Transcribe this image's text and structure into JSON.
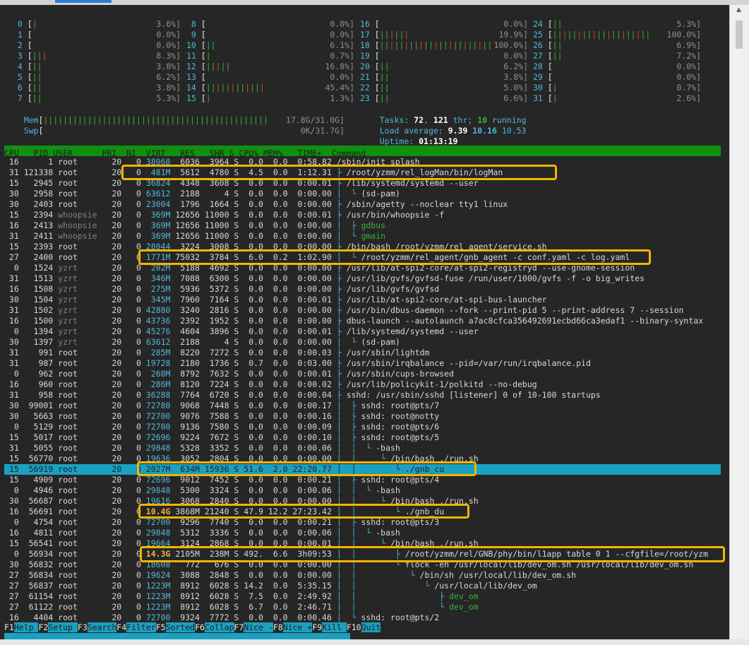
{
  "cpu_meters": [
    {
      "id": "0",
      "bar": "|",
      "pct": "3.6%]"
    },
    {
      "id": "1",
      "bar": "",
      "pct": "0.0%]"
    },
    {
      "id": "2",
      "bar": "",
      "pct": "0.0%]"
    },
    {
      "id": "3",
      "bar": "|||",
      "pct": "8.3%]"
    },
    {
      "id": "4",
      "bar": "||",
      "pct": "3.8%]"
    },
    {
      "id": "5",
      "bar": "||",
      "pct": "6.2%]"
    },
    {
      "id": "6",
      "bar": "||",
      "pct": "3.8%]"
    },
    {
      "id": "7",
      "bar": "||",
      "pct": "5.3%]"
    },
    {
      "id": "8",
      "bar": "",
      "pct": "0.0%]"
    },
    {
      "id": "9",
      "bar": "",
      "pct": "0.0%]"
    },
    {
      "id": "10",
      "bar": "||",
      "pct": "6.1%]"
    },
    {
      "id": "11",
      "bar": "|",
      "pct": "0.7%]"
    },
    {
      "id": "12",
      "bar": "|||||",
      "pct": "16.8%]"
    },
    {
      "id": "13",
      "bar": "",
      "pct": "0.0%]"
    },
    {
      "id": "14",
      "bar": "||||||||||||",
      "pct": "45.4%]"
    },
    {
      "id": "15",
      "bar": "|",
      "pct": "1.3%]"
    },
    {
      "id": "16",
      "bar": "",
      "pct": "0.0%]"
    },
    {
      "id": "17",
      "bar": "||||||",
      "pct": "19.9%]"
    },
    {
      "id": "18",
      "bar": "|||||||||||||||||||||||",
      "pct": "100.0%]"
    },
    {
      "id": "19",
      "bar": "",
      "pct": "0.0%]"
    },
    {
      "id": "20",
      "bar": "||",
      "pct": "6.2%]"
    },
    {
      "id": "21",
      "bar": "||",
      "pct": "3.8%]"
    },
    {
      "id": "22",
      "bar": "||",
      "pct": "5.0%]"
    },
    {
      "id": "23",
      "bar": "||",
      "pct": "6.6%]"
    },
    {
      "id": "24",
      "bar": "||",
      "pct": "5.3%]"
    },
    {
      "id": "25",
      "bar": "||||||||||||||||||||",
      "pct": "100.0%]"
    },
    {
      "id": "26",
      "bar": "||",
      "pct": "6.9%]"
    },
    {
      "id": "27",
      "bar": "||",
      "pct": "7.2%]"
    },
    {
      "id": "28",
      "bar": "",
      "pct": "0.0%]"
    },
    {
      "id": "29",
      "bar": "",
      "pct": "0.0%]"
    },
    {
      "id": "30",
      "bar": "|",
      "pct": "0.7%]"
    },
    {
      "id": "31",
      "bar": "|",
      "pct": "2.6%]"
    }
  ],
  "mem": {
    "label": "Mem",
    "bar": "||||||||||||||||||||||||||||||||||||||||||||||",
    "value": "17.8G/31.0G]"
  },
  "swp": {
    "label": "Swp",
    "bar": "",
    "value": "0K/31.7G]"
  },
  "tasks": {
    "label": "Tasks: ",
    "count": "72",
    "sep": ", ",
    "thr": "121",
    "thr_label": " thr; ",
    "running": "10",
    "running_label": " running"
  },
  "load": {
    "label": "Load average: ",
    "one": "9.39",
    "five": "10.16",
    "fifteen": "10.53"
  },
  "uptime": {
    "label": "Uptime: ",
    "value": "01:13:19"
  },
  "header": "CPU   PID USER      PRI  NI  VIRT   RES   SHR S CPU% MEM%   TIME+  Command",
  "processes": [
    {
      "cpu": "16",
      "pid": "1",
      "user": "root",
      "pri": "20",
      "ni": "0",
      "virt": "38068",
      "res": "6036",
      "shr": "3964",
      "s": "S",
      "cpupct": "0.0",
      "mem": "0.0",
      "time": "0:58.82",
      "tree": "",
      "cmd": "/sbin/init splash"
    },
    {
      "cpu": "31",
      "pid": "121338",
      "user": "root",
      "pri": "20",
      "ni": "0",
      "virt": "481M",
      "res": "5612",
      "shr": "4780",
      "s": "S",
      "cpupct": "4.5",
      "mem": "0.0",
      "time": "1:12.31",
      "tree": "├ ",
      "cmd": "/root/yzmm/rel_logMan/bin/logMan"
    },
    {
      "cpu": "15",
      "pid": "2945",
      "user": "root",
      "pri": "20",
      "ni": "0",
      "virt": "36824",
      "res": "4348",
      "shr": "3608",
      "s": "S",
      "cpupct": "0.0",
      "mem": "0.0",
      "time": "0:00.01",
      "tree": "├ ",
      "cmd": "/lib/systemd/systemd --user"
    },
    {
      "cpu": "30",
      "pid": "2958",
      "user": "root",
      "pri": "20",
      "ni": "0",
      "virt": "63612",
      "res": "2188",
      "shr": "4",
      "s": "S",
      "cpupct": "0.0",
      "mem": "0.0",
      "time": "0:00.00",
      "tree": "│  └ ",
      "cmd": "(sd-pam)"
    },
    {
      "cpu": "30",
      "pid": "2403",
      "user": "root",
      "pri": "20",
      "ni": "0",
      "virt": "23004",
      "res": "1796",
      "shr": "1664",
      "s": "S",
      "cpupct": "0.0",
      "mem": "0.0",
      "time": "0:00.00",
      "tree": "├ ",
      "cmd": "/sbin/agetty --noclear tty1 linux"
    },
    {
      "cpu": "15",
      "pid": "2394",
      "user": "whoopsie",
      "pri": "20",
      "ni": "0",
      "virt": "369M",
      "res": "12656",
      "shr": "11000",
      "s": "S",
      "cpupct": "0.0",
      "mem": "0.0",
      "time": "0:00.01",
      "tree": "├ ",
      "cmd": "/usr/bin/whoopsie -f"
    },
    {
      "cpu": "16",
      "pid": "2413",
      "user": "whoopsie",
      "pri": "20",
      "ni": "0",
      "virt": "369M",
      "res": "12656",
      "shr": "11000",
      "s": "S",
      "cpupct": "0.0",
      "mem": "0.0",
      "time": "0:00.00",
      "tree": "│  ├ ",
      "cmd": "gdbus",
      "thr": true
    },
    {
      "cpu": "31",
      "pid": "2411",
      "user": "whoopsie",
      "pri": "20",
      "ni": "0",
      "virt": "369M",
      "res": "12656",
      "shr": "11000",
      "s": "S",
      "cpupct": "0.0",
      "mem": "0.0",
      "time": "0:00.00",
      "tree": "│  └ ",
      "cmd": "gmain",
      "thr": true
    },
    {
      "cpu": "15",
      "pid": "2393",
      "user": "root",
      "pri": "20",
      "ni": "0",
      "virt": "28044",
      "res": "3224",
      "shr": "3008",
      "s": "S",
      "cpupct": "0.0",
      "mem": "0.0",
      "time": "0:00.00",
      "tree": "├ ",
      "cmd": "/bin/bash /root/yzmm/rel_agent/service.sh"
    },
    {
      "cpu": "27",
      "pid": "2400",
      "user": "root",
      "pri": "20",
      "ni": "0",
      "virt": "1771M",
      "res": "75032",
      "shr": "3784",
      "s": "S",
      "cpupct": "6.0",
      "mem": "0.2",
      "time": "1:02.90",
      "tree": "│  └ ",
      "cmd": "/root/yzmm/rel_agent/gnb_agent -c conf.yaml -c log.yaml"
    },
    {
      "cpu": "0",
      "pid": "1524",
      "user": "yzrt",
      "pri": "20",
      "ni": "0",
      "virt": "202M",
      "res": "5188",
      "shr": "4692",
      "s": "S",
      "cpupct": "0.0",
      "mem": "0.0",
      "time": "0:00.00",
      "tree": "├ ",
      "cmd": "/usr/lib/at-spi2-core/at-spi2-registryd --use-gnome-session"
    },
    {
      "cpu": "31",
      "pid": "1513",
      "user": "yzrt",
      "pri": "20",
      "ni": "0",
      "virt": "346M",
      "res": "7088",
      "shr": "6300",
      "s": "S",
      "cpupct": "0.0",
      "mem": "0.0",
      "time": "0:00.00",
      "tree": "├ ",
      "cmd": "/usr/lib/gvfs/gvfsd-fuse /run/user/1000/gvfs -f -o big_writes"
    },
    {
      "cpu": "16",
      "pid": "1508",
      "user": "yzrt",
      "pri": "20",
      "ni": "0",
      "virt": "275M",
      "res": "5936",
      "shr": "5372",
      "s": "S",
      "cpupct": "0.0",
      "mem": "0.0",
      "time": "0:00.00",
      "tree": "├ ",
      "cmd": "/usr/lib/gvfs/gvfsd"
    },
    {
      "cpu": "30",
      "pid": "1504",
      "user": "yzrt",
      "pri": "20",
      "ni": "0",
      "virt": "345M",
      "res": "7960",
      "shr": "7164",
      "s": "S",
      "cpupct": "0.0",
      "mem": "0.0",
      "time": "0:00.01",
      "tree": "├ ",
      "cmd": "/usr/lib/at-spi2-core/at-spi-bus-launcher"
    },
    {
      "cpu": "31",
      "pid": "1502",
      "user": "yzrt",
      "pri": "20",
      "ni": "0",
      "virt": "42880",
      "res": "3240",
      "shr": "2816",
      "s": "S",
      "cpupct": "0.0",
      "mem": "0.0",
      "time": "0:00.00",
      "tree": "├ ",
      "cmd": "/usr/bin/dbus-daemon --fork --print-pid 5 --print-address 7 --session"
    },
    {
      "cpu": "16",
      "pid": "1500",
      "user": "yzrt",
      "pri": "20",
      "ni": "0",
      "virt": "43736",
      "res": "2392",
      "shr": "1952",
      "s": "S",
      "cpupct": "0.0",
      "mem": "0.0",
      "time": "0:00.00",
      "tree": "├ ",
      "cmd": "dbus-launch --autolaunch a7ac8cfca356492691ecbd66ca3edaf1 --binary-syntax"
    },
    {
      "cpu": "0",
      "pid": "1394",
      "user": "yzrt",
      "pri": "20",
      "ni": "0",
      "virt": "45276",
      "res": "4604",
      "shr": "3896",
      "s": "S",
      "cpupct": "0.0",
      "mem": "0.0",
      "time": "0:00.01",
      "tree": "├ ",
      "cmd": "/lib/systemd/systemd --user"
    },
    {
      "cpu": "30",
      "pid": "1397",
      "user": "yzrt",
      "pri": "20",
      "ni": "0",
      "virt": "63612",
      "res": "2188",
      "shr": "4",
      "s": "S",
      "cpupct": "0.0",
      "mem": "0.0",
      "time": "0:00.00",
      "tree": "│  └ ",
      "cmd": "(sd-pam)"
    },
    {
      "cpu": "31",
      "pid": "991",
      "user": "root",
      "pri": "20",
      "ni": "0",
      "virt": "285M",
      "res": "8220",
      "shr": "7272",
      "s": "S",
      "cpupct": "0.0",
      "mem": "0.0",
      "time": "0:00.03",
      "tree": "├ ",
      "cmd": "/usr/sbin/lightdm"
    },
    {
      "cpu": "31",
      "pid": "987",
      "user": "root",
      "pri": "20",
      "ni": "0",
      "virt": "19728",
      "res": "2180",
      "shr": "1736",
      "s": "S",
      "cpupct": "0.7",
      "mem": "0.0",
      "time": "0:03.00",
      "tree": "├ ",
      "cmd": "/usr/sbin/irqbalance --pid=/var/run/irqbalance.pid"
    },
    {
      "cpu": "0",
      "pid": "962",
      "user": "root",
      "pri": "20",
      "ni": "0",
      "virt": "268M",
      "res": "8792",
      "shr": "7632",
      "s": "S",
      "cpupct": "0.0",
      "mem": "0.0",
      "time": "0:00.01",
      "tree": "├ ",
      "cmd": "/usr/sbin/cups-browsed"
    },
    {
      "cpu": "16",
      "pid": "960",
      "user": "root",
      "pri": "20",
      "ni": "0",
      "virt": "286M",
      "res": "8120",
      "shr": "7224",
      "s": "S",
      "cpupct": "0.0",
      "mem": "0.0",
      "time": "0:00.02",
      "tree": "├ ",
      "cmd": "/usr/lib/policykit-1/polkitd --no-debug"
    },
    {
      "cpu": "31",
      "pid": "958",
      "user": "root",
      "pri": "20",
      "ni": "0",
      "virt": "36288",
      "res": "7764",
      "shr": "6720",
      "s": "S",
      "cpupct": "0.0",
      "mem": "0.0",
      "time": "0:00.04",
      "tree": "├ ",
      "cmd": "sshd: /usr/sbin/sshd [listener] 0 of 10-100 startups"
    },
    {
      "cpu": "30",
      "pid": "99001",
      "user": "root",
      "pri": "20",
      "ni": "0",
      "virt": "72780",
      "res": "9068",
      "shr": "7448",
      "s": "S",
      "cpupct": "0.0",
      "mem": "0.0",
      "time": "0:00.17",
      "tree": "│  ├ ",
      "cmd": "sshd: root@pts/7"
    },
    {
      "cpu": "30",
      "pid": "5663",
      "user": "root",
      "pri": "20",
      "ni": "0",
      "virt": "72700",
      "res": "9076",
      "shr": "7588",
      "s": "S",
      "cpupct": "0.0",
      "mem": "0.0",
      "time": "0:00.16",
      "tree": "│  ├ ",
      "cmd": "sshd: root@notty"
    },
    {
      "cpu": "0",
      "pid": "5129",
      "user": "root",
      "pri": "20",
      "ni": "0",
      "virt": "72700",
      "res": "9136",
      "shr": "7580",
      "s": "S",
      "cpupct": "0.0",
      "mem": "0.0",
      "time": "0:00.09",
      "tree": "│  ├ ",
      "cmd": "sshd: root@pts/6"
    },
    {
      "cpu": "15",
      "pid": "5017",
      "user": "root",
      "pri": "20",
      "ni": "0",
      "virt": "72696",
      "res": "9224",
      "shr": "7672",
      "s": "S",
      "cpupct": "0.0",
      "mem": "0.0",
      "time": "0:00.10",
      "tree": "│  ├ ",
      "cmd": "sshd: root@pts/5"
    },
    {
      "cpu": "31",
      "pid": "5055",
      "user": "root",
      "pri": "20",
      "ni": "0",
      "virt": "29848",
      "res": "5328",
      "shr": "3352",
      "s": "S",
      "cpupct": "0.0",
      "mem": "0.0",
      "time": "0:00.06",
      "tree": "│  │  └ ",
      "cmd": "-bash"
    },
    {
      "cpu": "15",
      "pid": "56770",
      "user": "root",
      "pri": "20",
      "ni": "0",
      "virt": "19636",
      "res": "3052",
      "shr": "2804",
      "s": "S",
      "cpupct": "0.0",
      "mem": "0.0",
      "time": "0:00.00",
      "tree": "│  │     └ ",
      "cmd": "/bin/bash ./run.sh"
    },
    {
      "cpu": "15",
      "pid": "56919",
      "user": "root",
      "pri": "20",
      "ni": "0",
      "virt": "2027M",
      "res": "634M",
      "shr": "15936",
      "s": "S",
      "cpupct": "51.6",
      "mem": "2.0",
      "time": "22:20.77",
      "tree": "│  │        └ ",
      "cmd": "./gnb_cu",
      "selected": true
    },
    {
      "cpu": "15",
      "pid": "4909",
      "user": "root",
      "pri": "20",
      "ni": "0",
      "virt": "72696",
      "res": "9012",
      "shr": "7452",
      "s": "S",
      "cpupct": "0.0",
      "mem": "0.0",
      "time": "0:00.21",
      "tree": "│  ├ ",
      "cmd": "sshd: root@pts/4"
    },
    {
      "cpu": "0",
      "pid": "4946",
      "user": "root",
      "pri": "20",
      "ni": "0",
      "virt": "29848",
      "res": "5300",
      "shr": "3324",
      "s": "S",
      "cpupct": "0.0",
      "mem": "0.0",
      "time": "0:00.06",
      "tree": "│  │  └ ",
      "cmd": "-bash"
    },
    {
      "cpu": "30",
      "pid": "56687",
      "user": "root",
      "pri": "20",
      "ni": "0",
      "virt": "19616",
      "res": "3068",
      "shr": "2840",
      "s": "S",
      "cpupct": "0.0",
      "mem": "0.0",
      "time": "0:00.00",
      "tree": "│  │     └ ",
      "cmd": "/bin/bash ./run.sh"
    },
    {
      "cpu": "16",
      "pid": "56691",
      "user": "root",
      "pri": "20",
      "ni": "0",
      "virt": "10.4G",
      "res": "3868M",
      "shr": "21240",
      "s": "S",
      "cpupct": "47.9",
      "mem": "12.2",
      "time": "27:23.42",
      "tree": "│  │        └ ",
      "cmd": "./gnb_du",
      "big": true
    },
    {
      "cpu": "0",
      "pid": "4754",
      "user": "root",
      "pri": "20",
      "ni": "0",
      "virt": "72700",
      "res": "9296",
      "shr": "7740",
      "s": "S",
      "cpupct": "0.0",
      "mem": "0.0",
      "time": "0:00.21",
      "tree": "│  ├ ",
      "cmd": "sshd: root@pts/3"
    },
    {
      "cpu": "16",
      "pid": "4811",
      "user": "root",
      "pri": "20",
      "ni": "0",
      "virt": "29848",
      "res": "5312",
      "shr": "3336",
      "s": "S",
      "cpupct": "0.0",
      "mem": "0.0",
      "time": "0:00.06",
      "tree": "│  │  └ ",
      "cmd": "-bash"
    },
    {
      "cpu": "15",
      "pid": "56541",
      "user": "root",
      "pri": "20",
      "ni": "0",
      "virt": "19664",
      "res": "3124",
      "shr": "2868",
      "s": "S",
      "cpupct": "0.0",
      "mem": "0.0",
      "time": "0:00.01",
      "tree": "│  │     └ ",
      "cmd": "/bin/bash ./run.sh"
    },
    {
      "cpu": "0",
      "pid": "56934",
      "user": "root",
      "pri": "20",
      "ni": "0",
      "virt": "14.3G",
      "res": "2105M",
      "shr": "238M",
      "s": "S",
      "cpupct": "492.",
      "mem": "6.6",
      "time": "3h09:53",
      "tree": "│  │        ├ ",
      "cmd": "/root/yzmm/rel/GNB/phy/bin/l1app table 0 1 --cfgfile=/root/yzm",
      "big": true
    },
    {
      "cpu": "30",
      "pid": "56832",
      "user": "root",
      "pri": "20",
      "ni": "0",
      "virt": "18608",
      "res": "772",
      "shr": "676",
      "s": "S",
      "cpupct": "0.0",
      "mem": "0.0",
      "time": "0:00.00",
      "tree": "│  │        └ ",
      "cmd": "flock -en /usr/local/lib/dev_om.sh /usr/local/lib/dev_om.sh"
    },
    {
      "cpu": "27",
      "pid": "56834",
      "user": "root",
      "pri": "20",
      "ni": "0",
      "virt": "19624",
      "res": "3088",
      "shr": "2848",
      "s": "S",
      "cpupct": "0.0",
      "mem": "0.0",
      "time": "0:00.00",
      "tree": "│  │           └ ",
      "cmd": "/bin/sh /usr/local/lib/dev_om.sh"
    },
    {
      "cpu": "27",
      "pid": "56837",
      "user": "root",
      "pri": "20",
      "ni": "0",
      "virt": "1223M",
      "res": "8912",
      "shr": "6028",
      "s": "S",
      "cpupct": "14.2",
      "mem": "0.0",
      "time": "5:35.15",
      "tree": "│  │              └ ",
      "cmd": "/usr/local/lib/dev_om"
    },
    {
      "cpu": "27",
      "pid": "61154",
      "user": "root",
      "pri": "20",
      "ni": "0",
      "virt": "1223M",
      "res": "8912",
      "shr": "6028",
      "s": "S",
      "cpupct": "7.5",
      "mem": "0.0",
      "time": "2:49.92",
      "tree": "│  │                 ├ ",
      "cmd": "dev_om",
      "thr": true
    },
    {
      "cpu": "27",
      "pid": "61122",
      "user": "root",
      "pri": "20",
      "ni": "0",
      "virt": "1223M",
      "res": "8912",
      "shr": "6028",
      "s": "S",
      "cpupct": "6.7",
      "mem": "0.0",
      "time": "2:46.71",
      "tree": "│  │                 └ ",
      "cmd": "dev_om",
      "thr": true
    },
    {
      "cpu": "16",
      "pid": "4404",
      "user": "root",
      "pri": "20",
      "ni": "0",
      "virt": "72700",
      "res": "9324",
      "shr": "7772",
      "s": "S",
      "cpupct": "0.0",
      "mem": "0.0",
      "time": "0:00.46",
      "tree": "│  └ ",
      "cmd": "sshd: root@pts/2"
    }
  ],
  "fkeys": [
    {
      "k": "F1",
      "label": "Help  "
    },
    {
      "k": "F2",
      "label": "Setup "
    },
    {
      "k": "F3",
      "label": "Search"
    },
    {
      "k": "F4",
      "label": "Filter"
    },
    {
      "k": "F5",
      "label": "Sorted"
    },
    {
      "k": "F6",
      "label": "Collap"
    },
    {
      "k": "F7",
      "label": "Nice -"
    },
    {
      "k": "F8",
      "label": "Nice +"
    },
    {
      "k": "F9",
      "label": "Kill  "
    },
    {
      "k": "F10",
      "label": "Quit  "
    }
  ],
  "colors": {
    "accent": "#1aa0c0",
    "header_bg": "#109010",
    "highlight": "#f4b400",
    "terminal_bg": "#262626"
  }
}
